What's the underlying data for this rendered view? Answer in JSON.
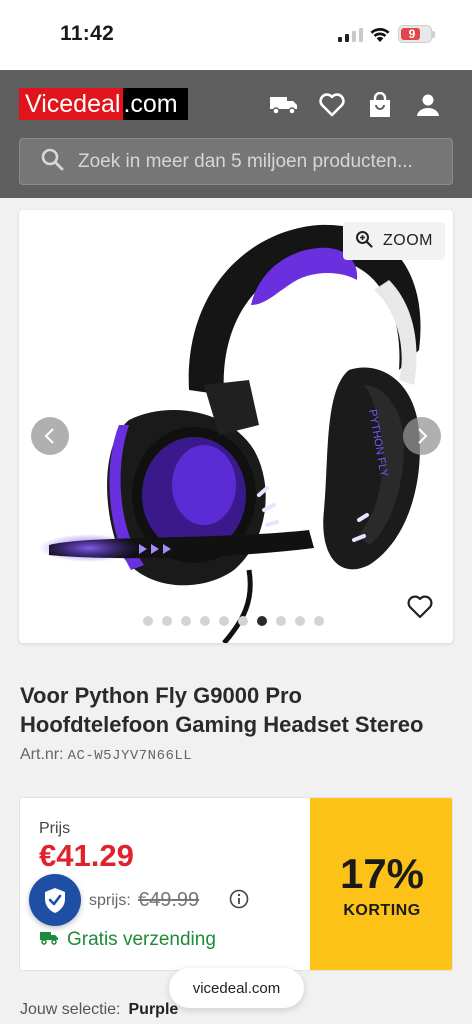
{
  "status_bar": {
    "time": "11:42",
    "battery": "9"
  },
  "header": {
    "logo_left": "Vicedeal",
    "logo_right": ".com",
    "search_placeholder": "Zoek in meer dan 5 miljoen producten..."
  },
  "gallery": {
    "zoom_label": "ZOOM",
    "dot_count": 10,
    "active_dot": 6
  },
  "product": {
    "title_line1": "Voor Python Fly G9000 Pro",
    "title_line2": "Hoofdtelefoon Gaming Headset Stereo",
    "artnr_label": "Art.nr:",
    "artnr_code": "AC-W5JYV7N66LL"
  },
  "pricing": {
    "price_label": "Prijs",
    "price": "€41.29",
    "advice_label": "sprijs:",
    "old_price": "€49.99",
    "shipping": "Gratis verzending",
    "discount_pct": "17%",
    "discount_label": "KORTING"
  },
  "selection": {
    "label": "Jouw selectie:",
    "value": "Purple"
  },
  "url": "vicedeal.com",
  "colors": {
    "brand_red": "#e2141b",
    "price_red": "#e0232b",
    "discount_yellow": "#fcc218",
    "shipping_green": "#1e8a3a",
    "shield_blue": "#1f4fa5",
    "headset_purple": "#5b2bd6"
  }
}
